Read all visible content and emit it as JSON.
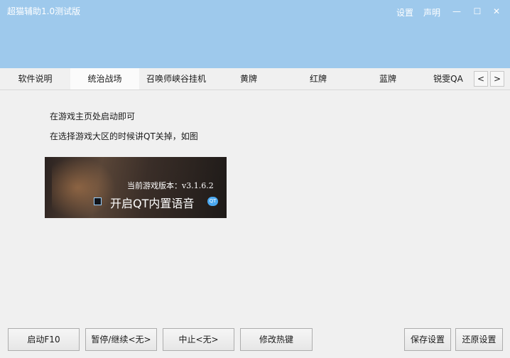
{
  "window": {
    "title": "超猫辅助1.0测试版",
    "links": {
      "settings": "设置",
      "statement": "声明"
    },
    "controls": {
      "minimize": "—",
      "maximize": "☐",
      "close": "✕"
    }
  },
  "tabs": [
    {
      "label": "软件说明",
      "active": false
    },
    {
      "label": "统治战场",
      "active": true
    },
    {
      "label": "召唤师峡谷挂机",
      "active": false
    },
    {
      "label": "黄牌",
      "active": false
    },
    {
      "label": "红牌",
      "active": false
    },
    {
      "label": "蓝牌",
      "active": false
    },
    {
      "label": "锐雯QA",
      "active": false
    }
  ],
  "tab_scroll": {
    "prev": "<",
    "next": ">"
  },
  "content": {
    "line1": "在游戏主页处启动即可",
    "line2": "在选择游戏大区的时候讲QT关掉，如图",
    "preview": {
      "version_label": "当前游戏版本：v3.1.6.2",
      "qt_voice_label": "开启QT内置语音",
      "qt_icon_text": "QT",
      "qt_checked": false
    }
  },
  "buttons": {
    "start": "启动F10",
    "pause": "暂停/继续<无>",
    "stop": "中止<无>",
    "hotkey": "修改热键",
    "save": "保存设置",
    "restore": "还原设置"
  },
  "colors": {
    "titlebar": "#9ec9ec",
    "active_tab": "#fbfbfb",
    "background": "#f0f0f0"
  }
}
